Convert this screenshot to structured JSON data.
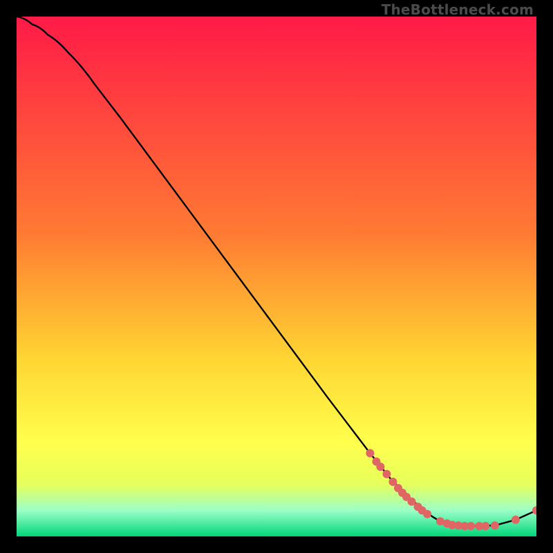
{
  "watermark": "TheBottleneck.com",
  "colors": {
    "line": "#000000",
    "marker": "#e06666",
    "grad_top": "#ff1a47",
    "grad_mid1": "#ff7b33",
    "grad_mid2": "#ffd633",
    "grad_low1": "#ffff4d",
    "grad_low2": "#e6ff5c",
    "grad_band": "#9cffc7",
    "grad_bottom": "#00d67a"
  },
  "chart_data": {
    "type": "line",
    "title": "",
    "xlabel": "",
    "ylabel": "",
    "xlim": [
      0,
      100
    ],
    "ylim": [
      0,
      100
    ],
    "curve": [
      {
        "x": 0,
        "y": 100
      },
      {
        "x": 3,
        "y": 98.5
      },
      {
        "x": 6,
        "y": 96.5
      },
      {
        "x": 10,
        "y": 93.0
      },
      {
        "x": 15,
        "y": 87.0
      },
      {
        "x": 20,
        "y": 80.5
      },
      {
        "x": 30,
        "y": 67.0
      },
      {
        "x": 40,
        "y": 53.5
      },
      {
        "x": 50,
        "y": 40.0
      },
      {
        "x": 60,
        "y": 26.5
      },
      {
        "x": 68,
        "y": 16.0
      },
      {
        "x": 72,
        "y": 11.0
      },
      {
        "x": 76,
        "y": 7.0
      },
      {
        "x": 80,
        "y": 3.8
      },
      {
        "x": 82,
        "y": 2.6
      },
      {
        "x": 84,
        "y": 2.1
      },
      {
        "x": 88,
        "y": 2.0
      },
      {
        "x": 92,
        "y": 2.1
      },
      {
        "x": 96,
        "y": 3.2
      },
      {
        "x": 100,
        "y": 5.0
      }
    ],
    "markers": [
      {
        "x": 68.0,
        "y": 16.0
      },
      {
        "x": 69.2,
        "y": 14.4
      },
      {
        "x": 70.0,
        "y": 13.4
      },
      {
        "x": 71.2,
        "y": 12.0
      },
      {
        "x": 72.4,
        "y": 10.5
      },
      {
        "x": 73.4,
        "y": 9.3
      },
      {
        "x": 74.2,
        "y": 8.4
      },
      {
        "x": 75.0,
        "y": 7.6
      },
      {
        "x": 76.0,
        "y": 6.7
      },
      {
        "x": 77.2,
        "y": 5.7
      },
      {
        "x": 78.0,
        "y": 5.0
      },
      {
        "x": 79.0,
        "y": 4.3
      },
      {
        "x": 81.5,
        "y": 2.9
      },
      {
        "x": 82.8,
        "y": 2.5
      },
      {
        "x": 83.8,
        "y": 2.2
      },
      {
        "x": 85.0,
        "y": 2.1
      },
      {
        "x": 86.2,
        "y": 2.0
      },
      {
        "x": 87.4,
        "y": 2.0
      },
      {
        "x": 89.0,
        "y": 2.0
      },
      {
        "x": 90.2,
        "y": 2.0
      },
      {
        "x": 92.0,
        "y": 2.1
      },
      {
        "x": 96.0,
        "y": 3.2
      },
      {
        "x": 100.0,
        "y": 5.0
      }
    ],
    "marker_radius": 6
  }
}
